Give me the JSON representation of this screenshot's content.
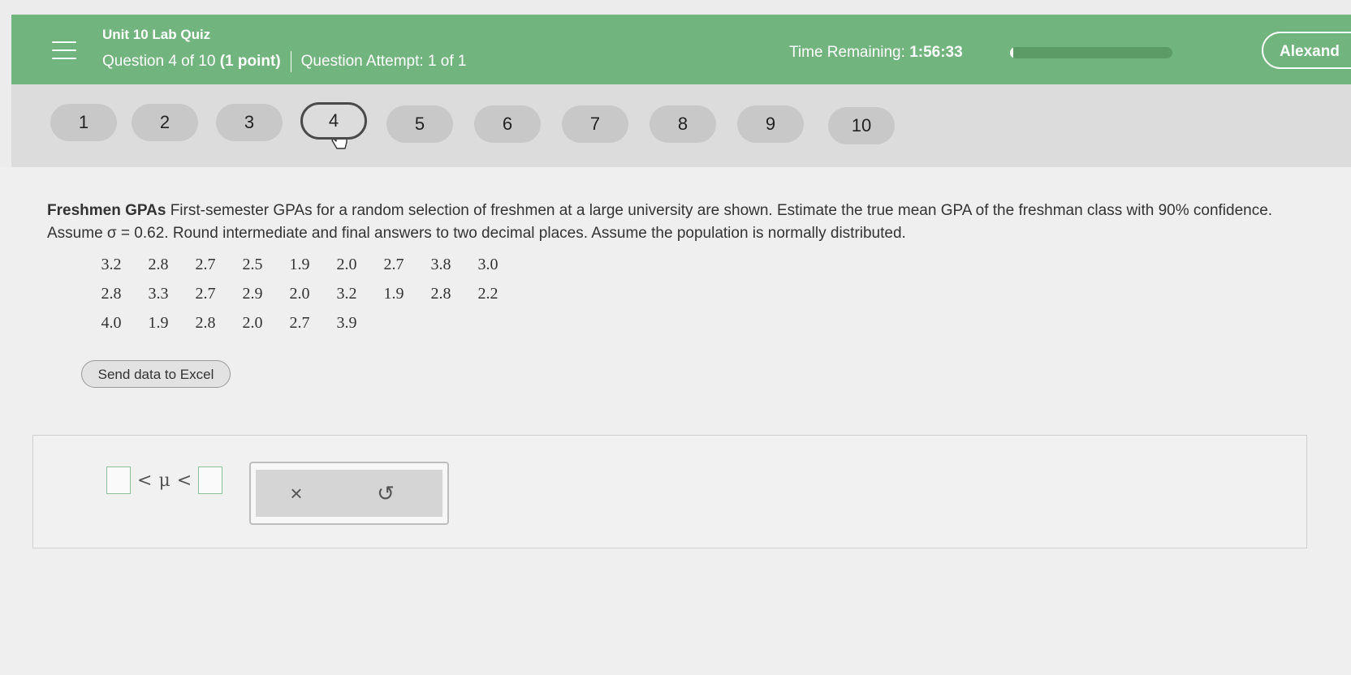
{
  "header": {
    "title": "Unit 10 Lab Quiz",
    "question_label": "Question 4 of 10",
    "points": "(1 point)",
    "attempt_label": "Question Attempt: 1 of 1",
    "time_label": "Time Remaining:",
    "time_value": "1:56:33",
    "time_progress_fraction": 0.02,
    "user_name": "Alexand",
    "colors": {
      "header_bg": "#72b47e",
      "text": "#ffffff"
    }
  },
  "nav": {
    "current": "4",
    "questions": [
      "1",
      "2",
      "3",
      "4",
      "5",
      "6",
      "7",
      "8",
      "9",
      "10"
    ]
  },
  "problem": {
    "title": "Freshmen GPAs",
    "text": "First-semester GPAs for a random selection of freshmen at a large university are shown. Estimate the true mean GPA of the freshman class with 90% confidence. Assume σ = 0.62. Round intermediate and final answers to two decimal places. Assume the population is normally distributed.",
    "data_rows": [
      [
        "3.2",
        "2.8",
        "2.7",
        "2.5",
        "1.9",
        "2.0",
        "2.7",
        "3.8",
        "3.0"
      ],
      [
        "2.8",
        "3.3",
        "2.7",
        "2.9",
        "2.0",
        "3.2",
        "1.9",
        "2.8",
        "2.2"
      ],
      [
        "4.0",
        "1.9",
        "2.8",
        "2.0",
        "2.7",
        "3.9"
      ]
    ],
    "excel_button": "Send data to Excel"
  },
  "answer": {
    "lower_value": "",
    "upper_value": "",
    "relation_left": "<",
    "symbol": "μ",
    "relation_right": "<",
    "tools": {
      "clear_icon": "×",
      "undo_icon": "↺"
    }
  }
}
